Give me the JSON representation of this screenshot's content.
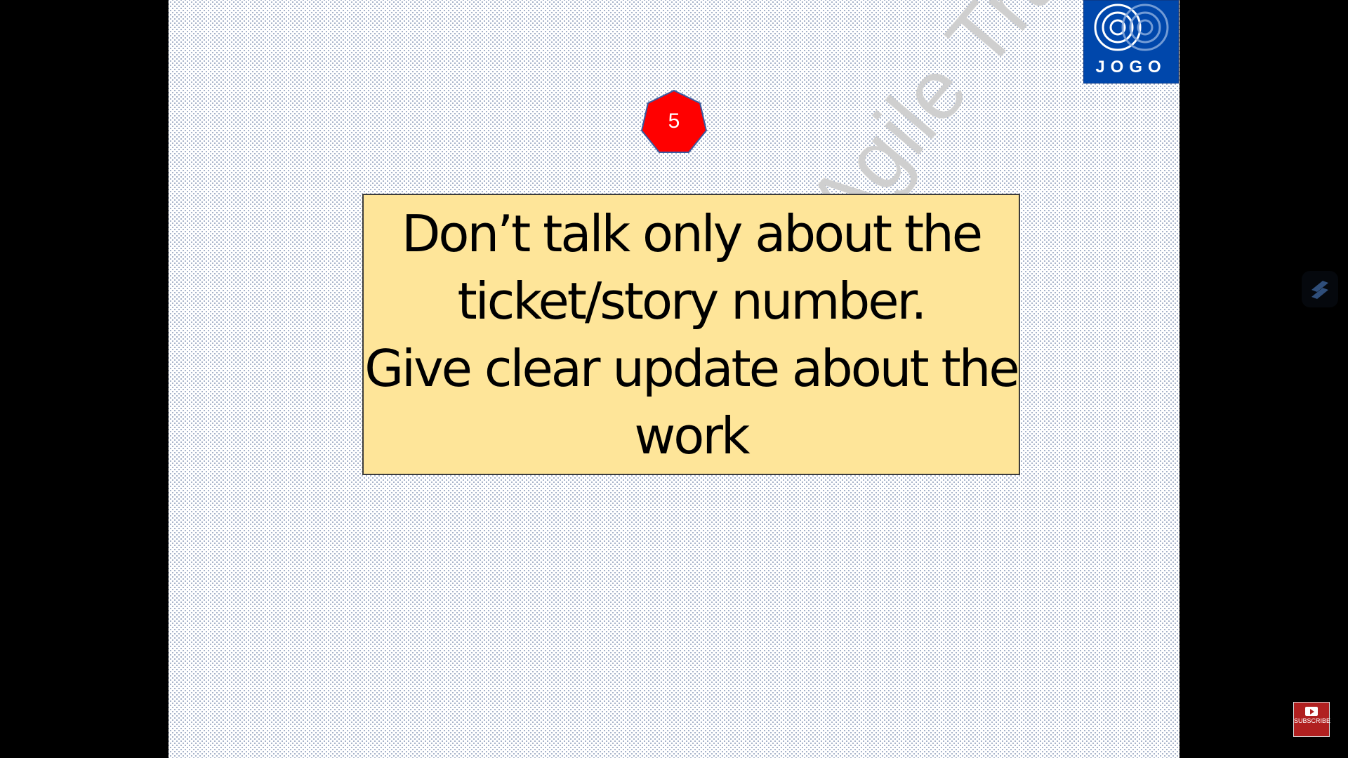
{
  "slide": {
    "watermark": "JOGO Agile Training",
    "logo": {
      "text": "JOGO",
      "color": "#0047ab"
    },
    "badge": {
      "number": "5",
      "color": "#ff0000"
    },
    "card": {
      "text": "Don’t talk only about the\nticket/story number.\nGive clear update about the\nwork",
      "color": "#fee599"
    }
  },
  "overlay": {
    "side_icon": "app-logo-icon",
    "subscribe_label": "SUBSCRIBE"
  }
}
